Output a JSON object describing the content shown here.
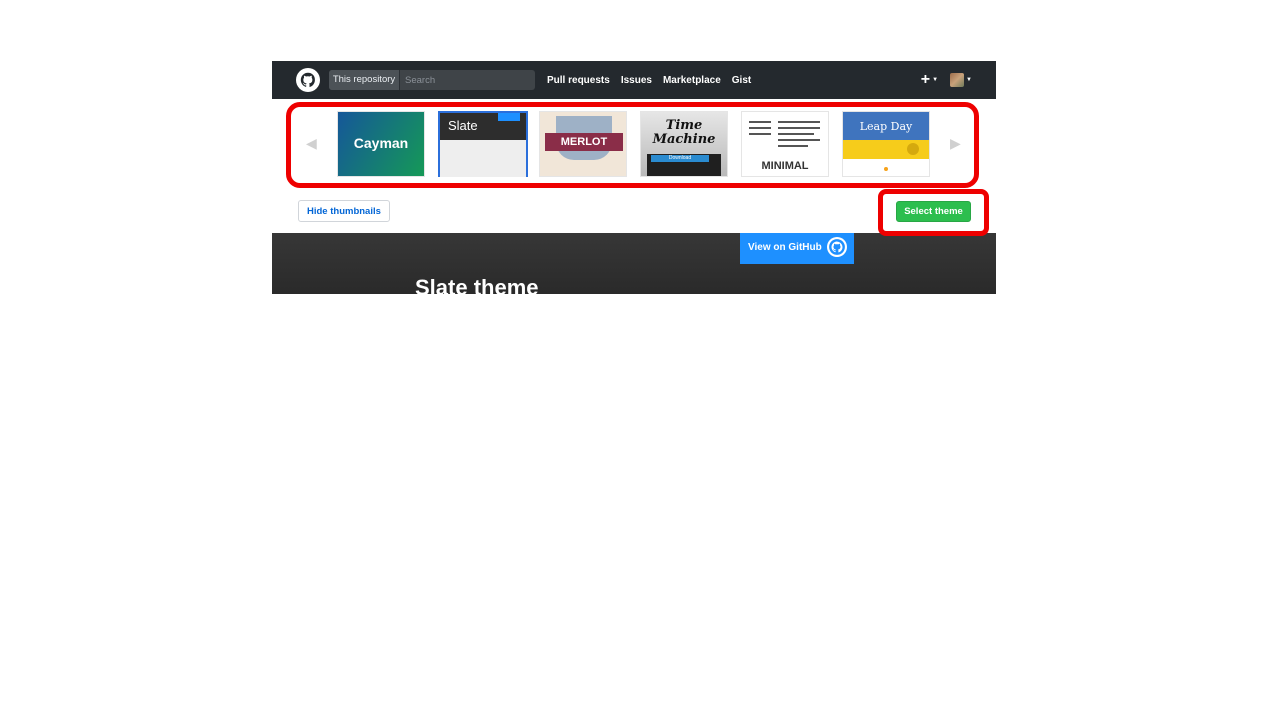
{
  "header": {
    "search_scope": "This repository",
    "search_placeholder": "Search",
    "nav": [
      "Pull requests",
      "Issues",
      "Marketplace",
      "Gist"
    ],
    "plus_icon": "plus-icon",
    "avatar": "user-avatar"
  },
  "carousel": {
    "prev_icon": "arrow-left-icon",
    "next_icon": "arrow-right-icon",
    "themes": [
      "Cayman",
      "Slate",
      "MERLOT",
      "Time Machine",
      "MINIMAL",
      "Leap Day"
    ],
    "time_machine_button": "Download",
    "selected": "Slate"
  },
  "actions": {
    "hide_thumbnails": "Hide thumbnails",
    "select_theme": "Select theme"
  },
  "preview": {
    "view_on_github": "View on GitHub",
    "title": "Slate theme"
  },
  "colors": {
    "header_bg": "#24292e",
    "select_green": "#2cbe4e",
    "selected_border": "#2b6fdb",
    "annotation_red": "#ee0000"
  }
}
